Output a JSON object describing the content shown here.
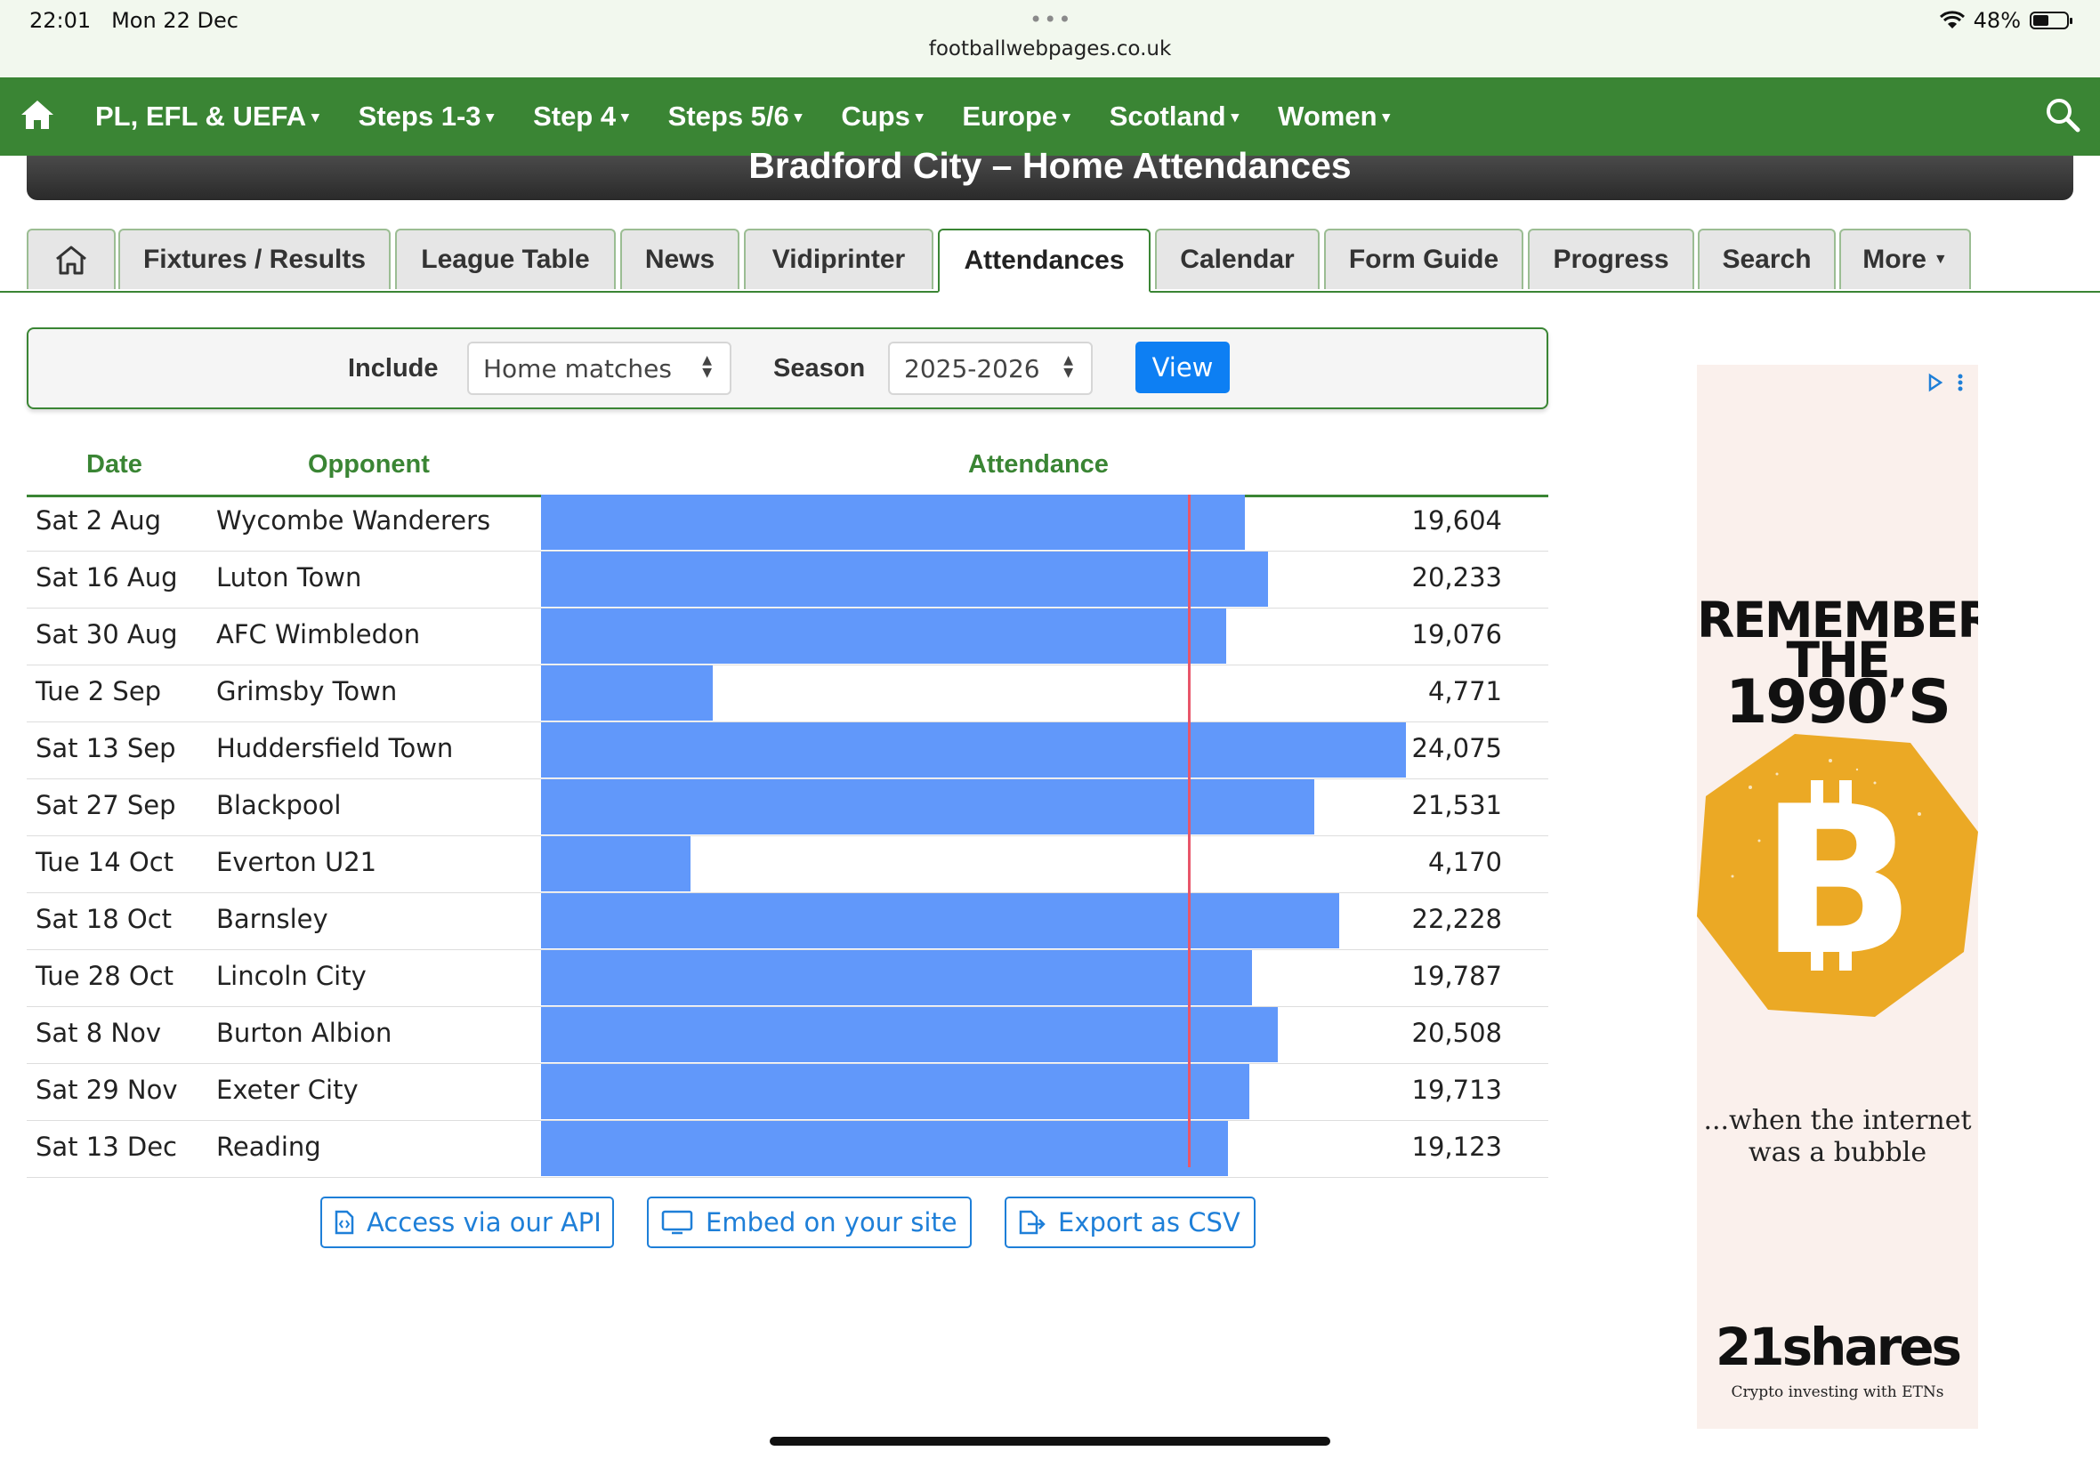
{
  "status_bar": {
    "time": "22:01",
    "date": "Mon 22 Dec",
    "dots": "•••",
    "url": "footballwebpages.co.uk",
    "battery": "48%",
    "battery_level": 0.48
  },
  "nav": {
    "items": [
      "PL, EFL & UEFA",
      "Steps 1-3",
      "Step 4",
      "Steps 5/6",
      "Cups",
      "Europe",
      "Scotland",
      "Women"
    ],
    "caret": "▾"
  },
  "page_title": "Bradford City – Home Attendances",
  "tabs": [
    "Fixtures / Results",
    "League Table",
    "News",
    "Vidiprinter",
    "Attendances",
    "Calendar",
    "Form Guide",
    "Progress",
    "Search",
    "More"
  ],
  "active_tab": "Attendances",
  "filter": {
    "include_label": "Include",
    "include_value": "Home matches",
    "season_label": "Season",
    "season_value": "2025-2026",
    "view_label": "View"
  },
  "table": {
    "headers": {
      "date": "Date",
      "opponent": "Opponent",
      "attendance": "Attendance"
    },
    "scale_max": 24075,
    "average_marker": 18005,
    "rows": [
      {
        "date": "Sat 2 Aug",
        "opponent": "Wycombe Wanderers",
        "attendance": "19,604",
        "value": 19604
      },
      {
        "date": "Sat 16 Aug",
        "opponent": "Luton Town",
        "attendance": "20,233",
        "value": 20233
      },
      {
        "date": "Sat 30 Aug",
        "opponent": "AFC Wimbledon",
        "attendance": "19,076",
        "value": 19076
      },
      {
        "date": "Tue 2 Sep",
        "opponent": "Grimsby Town",
        "attendance": "4,771",
        "value": 4771
      },
      {
        "date": "Sat 13 Sep",
        "opponent": "Huddersfield Town",
        "attendance": "24,075",
        "value": 24075
      },
      {
        "date": "Sat 27 Sep",
        "opponent": "Blackpool",
        "attendance": "21,531",
        "value": 21531
      },
      {
        "date": "Tue 14 Oct",
        "opponent": "Everton U21",
        "attendance": "4,170",
        "value": 4170
      },
      {
        "date": "Sat 18 Oct",
        "opponent": "Barnsley",
        "attendance": "22,228",
        "value": 22228
      },
      {
        "date": "Tue 28 Oct",
        "opponent": "Lincoln City",
        "attendance": "19,787",
        "value": 19787
      },
      {
        "date": "Sat 8 Nov",
        "opponent": "Burton Albion",
        "attendance": "20,508",
        "value": 20508
      },
      {
        "date": "Sat 29 Nov",
        "opponent": "Exeter City",
        "attendance": "19,713",
        "value": 19713
      },
      {
        "date": "Sat 13 Dec",
        "opponent": "Reading",
        "attendance": "19,123",
        "value": 19123
      }
    ]
  },
  "actions": {
    "api": "Access via our API",
    "embed": "Embed on your site",
    "csv": "Export as CSV"
  },
  "ad": {
    "headline_1": "REMEMBER",
    "headline_2": "THE",
    "headline_3": "1990’S",
    "tagline_1": "...when the internet",
    "tagline_2": "was a bubble",
    "brand": "21shares",
    "sub": "Crypto investing with ETNs",
    "colors": {
      "coin": "#eba925",
      "background": "#faf0ec"
    }
  },
  "colors": {
    "nav": "#3a8534",
    "bar": "#6198fa",
    "avg_line": "#e8566a",
    "button": "#0d7ff3"
  }
}
